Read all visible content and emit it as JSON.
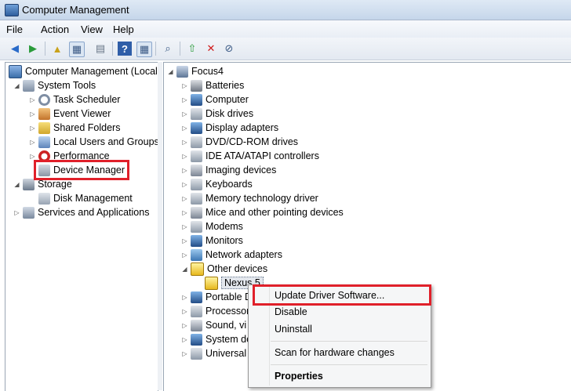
{
  "window": {
    "title": "Computer Management"
  },
  "menu": [
    "File",
    "Action",
    "View",
    "Help"
  ],
  "toolbar": {
    "icons": [
      "back-arrow-icon",
      "forward-arrow-icon",
      "up-folder-icon",
      "show-hide-tree-icon",
      "properties-icon",
      "help-icon",
      "show-action-pane-icon",
      "scan-hardware-icon",
      "update-driver-icon",
      "uninstall-icon",
      "disable-icon"
    ]
  },
  "left_tree": {
    "root": "Computer Management (Local",
    "system_tools": "System Tools",
    "task_scheduler": "Task Scheduler",
    "event_viewer": "Event Viewer",
    "shared_folders": "Shared Folders",
    "local_users": "Local Users and Groups",
    "performance": "Performance",
    "device_manager": "Device Manager",
    "storage": "Storage",
    "disk_management": "Disk Management",
    "services": "Services and Applications"
  },
  "device_tree": {
    "root": "Focus4",
    "categories": [
      "Batteries",
      "Computer",
      "Disk drives",
      "Display adapters",
      "DVD/CD-ROM drives",
      "IDE ATA/ATAPI controllers",
      "Imaging devices",
      "Keyboards",
      "Memory technology driver",
      "Mice and other pointing devices",
      "Modems",
      "Monitors",
      "Network adapters",
      "Other devices"
    ],
    "nexus": "Nexus 5",
    "after": [
      "Portable D",
      "Processor",
      "Sound, vi",
      "System de",
      "Universal"
    ]
  },
  "context_menu": {
    "update": "Update Driver Software...",
    "disable": "Disable",
    "uninstall": "Uninstall",
    "scan": "Scan for hardware changes",
    "properties": "Properties"
  },
  "colors": {
    "highlight_box": "#e0202a",
    "title_bar": "#dfe9f5"
  }
}
